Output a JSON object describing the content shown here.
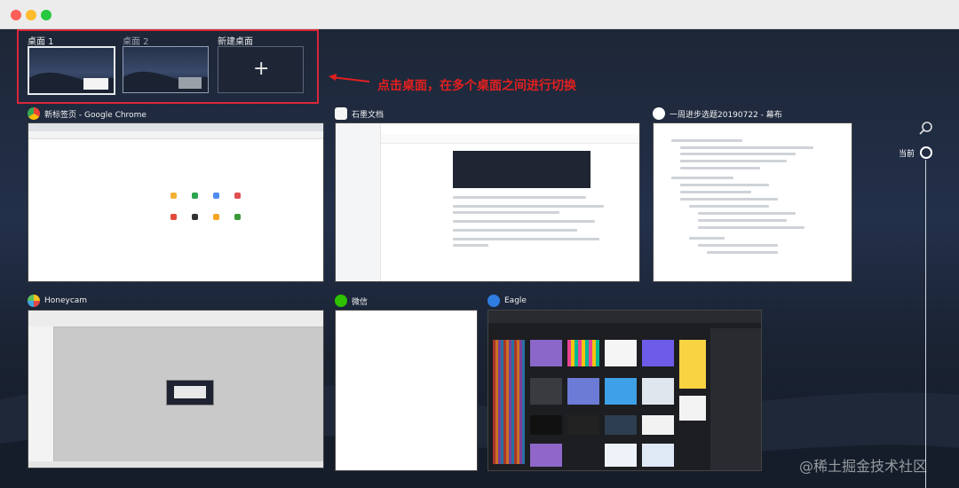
{
  "desktops": [
    {
      "label": "桌面 1"
    },
    {
      "label": "桌面 2"
    },
    {
      "label": "新建桌面",
      "icon": "plus-icon"
    }
  ],
  "annotation": {
    "text": "点击桌面，在多个桌面之间进行切换",
    "color": "#e02020"
  },
  "windows": [
    {
      "title": "新标签页 - Google Chrome",
      "icon": "chrome-icon"
    },
    {
      "title": "石墨文档",
      "icon": "shimo-icon"
    },
    {
      "title": "一周进步选题20190722 - 幕布",
      "icon": "mubu-icon"
    },
    {
      "title": "Honeycam",
      "icon": "honeycam-icon"
    },
    {
      "title": "微信",
      "icon": "wechat-icon"
    },
    {
      "title": "Eagle",
      "icon": "eagle-icon"
    }
  ],
  "timeline": {
    "current_label": "当前"
  },
  "watermark": "@稀土掘金技术社区",
  "colors": {
    "accent_red": "#e02020",
    "selection_border": "#d9263a"
  }
}
